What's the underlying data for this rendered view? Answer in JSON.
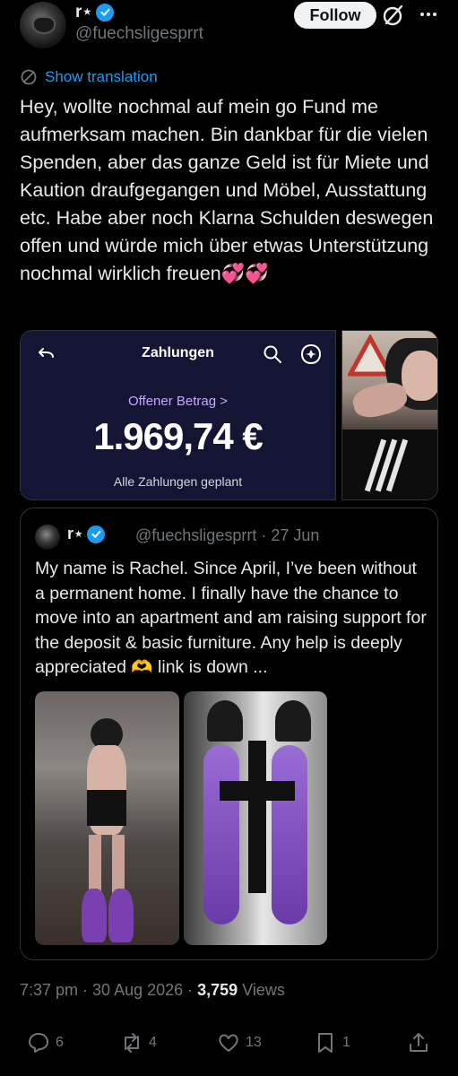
{
  "author": {
    "display_name": "r⋆",
    "handle": "@fuechsligesprrt",
    "verified": true
  },
  "follow_label": "Follow",
  "translation_label": "Show translation",
  "post_text": "Hey, wollte nochmal auf mein go Fund me aufmerksam machen. Bin dankbar für die vielen Spenden, aber das ganze Geld ist für Miete und Kaution draufgegangen und Möbel, Ausstattung etc. Habe aber noch Klarna Schulden deswegen offen und würde mich über etwas Unterstützung nochmal wirklich freuen💞💞",
  "payment_screenshot": {
    "title": "Zahlungen",
    "amount_label": "Offener Betrag >",
    "amount": "1.969,74 €",
    "status": "Alle Zahlungen geplant"
  },
  "quote": {
    "display_name": "r⋆",
    "meta": "@fuechsligesprrt · 27 Jun",
    "text": "My name is Rachel. Since April, I’ve been without a permanent home. I finally have the chance to move into an apartment and am raising support for the deposit & basic furniture. Any help is deeply appreciated 🫶 link is down ..."
  },
  "footer": {
    "time_date": "7:37 pm · 30 Aug 2026 · ",
    "views_count": "3,759",
    "views_label": " Views"
  },
  "actions": {
    "replies": "6",
    "reposts": "4",
    "likes": "13",
    "bookmarks": "1"
  },
  "colors": {
    "background": "#000000",
    "accent": "#1d9bf0",
    "muted": "#71767b",
    "klarna_panel": "#141434"
  },
  "icons": [
    "verified-badge-icon",
    "grok-icon",
    "more-icon",
    "globe-icon",
    "back-arrow-icon",
    "search-icon",
    "help-icon",
    "reply-icon",
    "repost-icon",
    "like-icon",
    "bookmark-icon",
    "share-icon"
  ]
}
